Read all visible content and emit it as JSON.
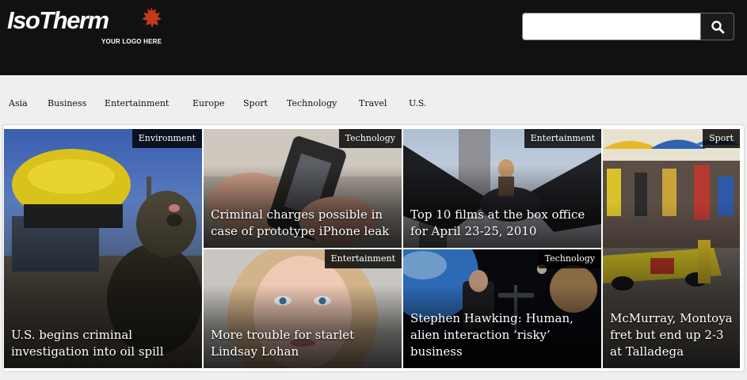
{
  "site": {
    "logo_text": "IsoTherm",
    "logo_tagline": "YOUR LOGO HERE",
    "logo_mark_icon": "maple-leaf-icon",
    "accent_color": "#c4391c"
  },
  "search": {
    "value": "",
    "placeholder": "",
    "button_icon": "search-icon"
  },
  "nav": {
    "items": [
      {
        "label": "Asia"
      },
      {
        "label": "Business"
      },
      {
        "label": "Entertainment"
      },
      {
        "label": "Europe"
      },
      {
        "label": "Sport"
      },
      {
        "label": "Technology"
      },
      {
        "label": "Travel"
      },
      {
        "label": "U.S."
      }
    ]
  },
  "stories": [
    {
      "category": "Environment",
      "headline": "U.S. begins criminal investigation into oil spill"
    },
    {
      "category": "Technology",
      "headline": "Criminal charges possible in case of prototype iPhone leak"
    },
    {
      "category": "Entertainment",
      "headline": "Top 10 films at the box office for April 23-25, 2010"
    },
    {
      "category": "Sport",
      "headline": "McMurray, Montoya fret but end up 2-3 at Talladega"
    },
    {
      "category": "Entertainment",
      "headline": "More trouble for starlet Lindsay Lohan"
    },
    {
      "category": "Technology",
      "headline": "Stephen Hawking: Human, alien interaction ‘risky’ business"
    }
  ]
}
